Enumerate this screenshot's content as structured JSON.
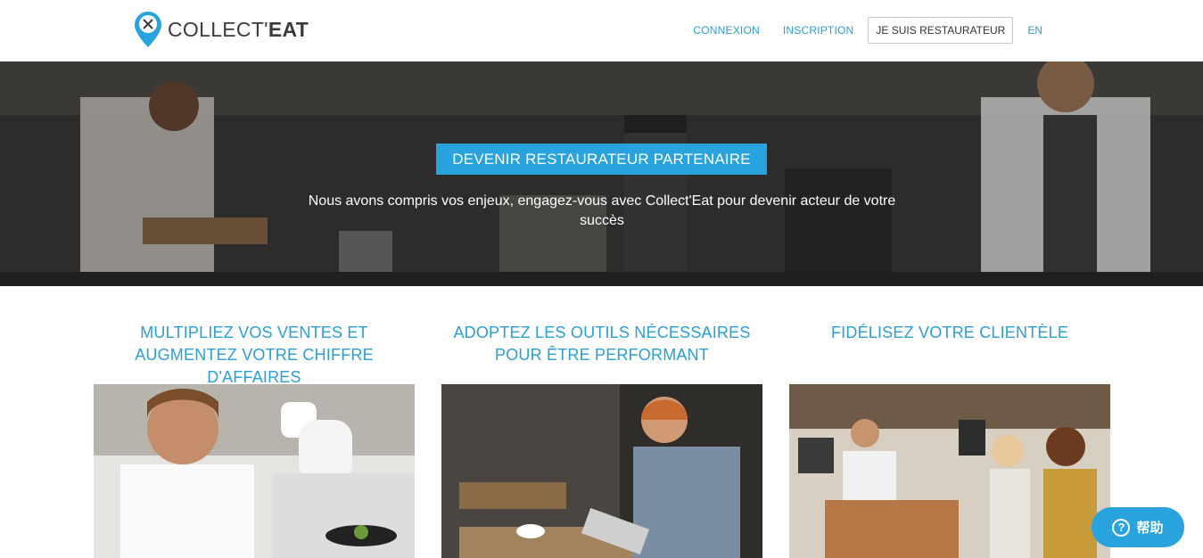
{
  "brand": {
    "name_light": "COLLECT'",
    "name_bold": "EAT",
    "accent": "#29a3dd"
  },
  "nav": {
    "login": "CONNEXION",
    "signup": "INSCRIPTION",
    "restaurateur": "JE SUIS RESTAURATEUR",
    "language": "EN"
  },
  "hero": {
    "cta_label": "DEVENIR RESTAURATEUR PARTENAIRE",
    "subtitle": "Nous avons compris vos enjeux, engagez-vous avec Collect'Eat pour devenir acteur de votre succès"
  },
  "features": [
    {
      "title": "MULTIPLIEZ VOS VENTES ET AUGMENTEZ VOTRE CHIFFRE D'AFFAIRES"
    },
    {
      "title": "ADOPTEZ LES OUTILS NÉCESSAIRES POUR ÊTRE PERFORMANT"
    },
    {
      "title": "FIDÉLISEZ VOTRE CLIENTÈLE"
    }
  ],
  "help": {
    "label": "帮助",
    "icon": "question-icon"
  }
}
